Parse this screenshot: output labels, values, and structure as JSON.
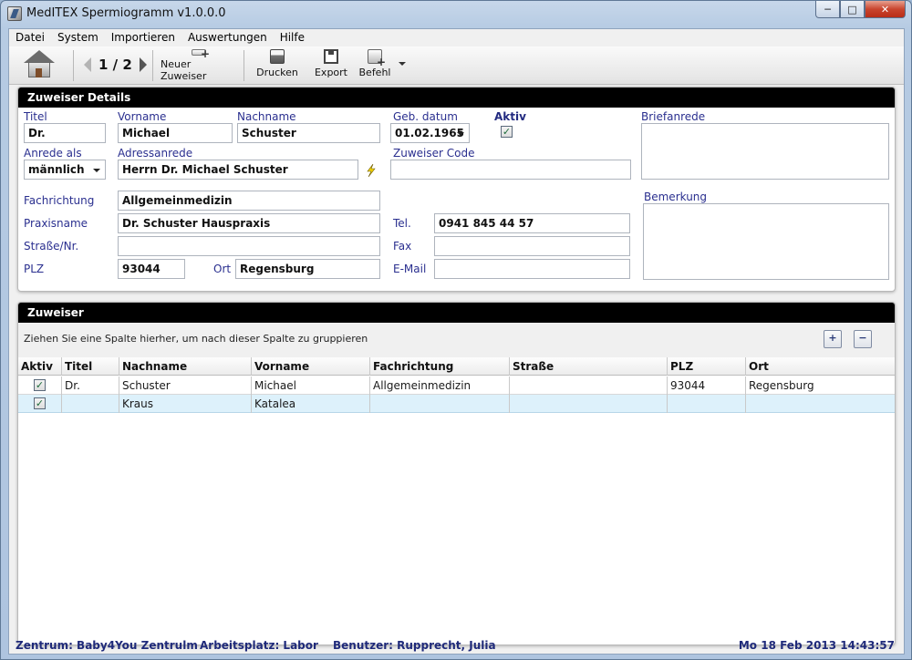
{
  "window": {
    "title": "MedITEX Spermiogramm v1.0.0.0"
  },
  "menu": [
    "Datei",
    "System",
    "Importieren",
    "Auswertungen",
    "Hilfe"
  ],
  "toolbar": {
    "page_indicator": "1 / 2",
    "new_referrer": "Neuer Zuweiser",
    "print": "Drucken",
    "export": "Export",
    "command": "Befehl"
  },
  "details": {
    "header": "Zuweiser Details",
    "labels": {
      "title": "Titel",
      "first_name": "Vorname",
      "last_name": "Nachname",
      "birth_date": "Geb. datum",
      "active": "Aktiv",
      "letter_salutation": "Briefanrede",
      "salutation_as": "Anrede als",
      "address_salutation": "Adressanrede",
      "referrer_code": "Zuweiser Code",
      "specialty": "Fachrichtung",
      "practice_name": "Praxisname",
      "street": "Straße/Nr.",
      "zip": "PLZ",
      "city": "Ort",
      "phone": "Tel.",
      "fax": "Fax",
      "email": "E-Mail",
      "remark": "Bemerkung"
    },
    "values": {
      "title": "Dr.",
      "first_name": "Michael",
      "last_name": "Schuster",
      "birth_date": "01.02.1965",
      "active_check": "✓",
      "letter_salutation": "",
      "salutation_as": "männlich",
      "address_salutation": "Herrn Dr. Michael Schuster",
      "referrer_code": "",
      "specialty": "Allgemeinmedizin",
      "practice_name": "Dr. Schuster Hauspraxis",
      "street": "",
      "zip": "93044",
      "city": "Regensburg",
      "phone": "0941 845 44 57",
      "fax": "",
      "email": "",
      "remark": ""
    }
  },
  "list": {
    "header": "Zuweiser",
    "group_hint": "Ziehen Sie eine Spalte hierher, um nach dieser Spalte zu gruppieren",
    "expand": "+",
    "collapse": "−",
    "columns": [
      "Aktiv",
      "Titel",
      "Nachname",
      "Vorname",
      "Fachrichtung",
      "Straße",
      "PLZ",
      "Ort"
    ],
    "rows": [
      {
        "active": "✓",
        "title": "Dr.",
        "last_name": "Schuster",
        "first_name": "Michael",
        "specialty": "Allgemeinmedizin",
        "street": "",
        "zip": "93044",
        "city": "Regensburg"
      },
      {
        "active": "✓",
        "title": "",
        "last_name": "Kraus",
        "first_name": "Katalea",
        "specialty": "",
        "street": "",
        "zip": "",
        "city": ""
      }
    ]
  },
  "status": {
    "center": "Zentrum: Baby4You Zentrulm",
    "workplace": "Arbeitsplatz: Labor",
    "user": "Benutzer: Rupprecht, Julia",
    "datetime": "Mo 18 Feb 2013 14:43:57"
  }
}
